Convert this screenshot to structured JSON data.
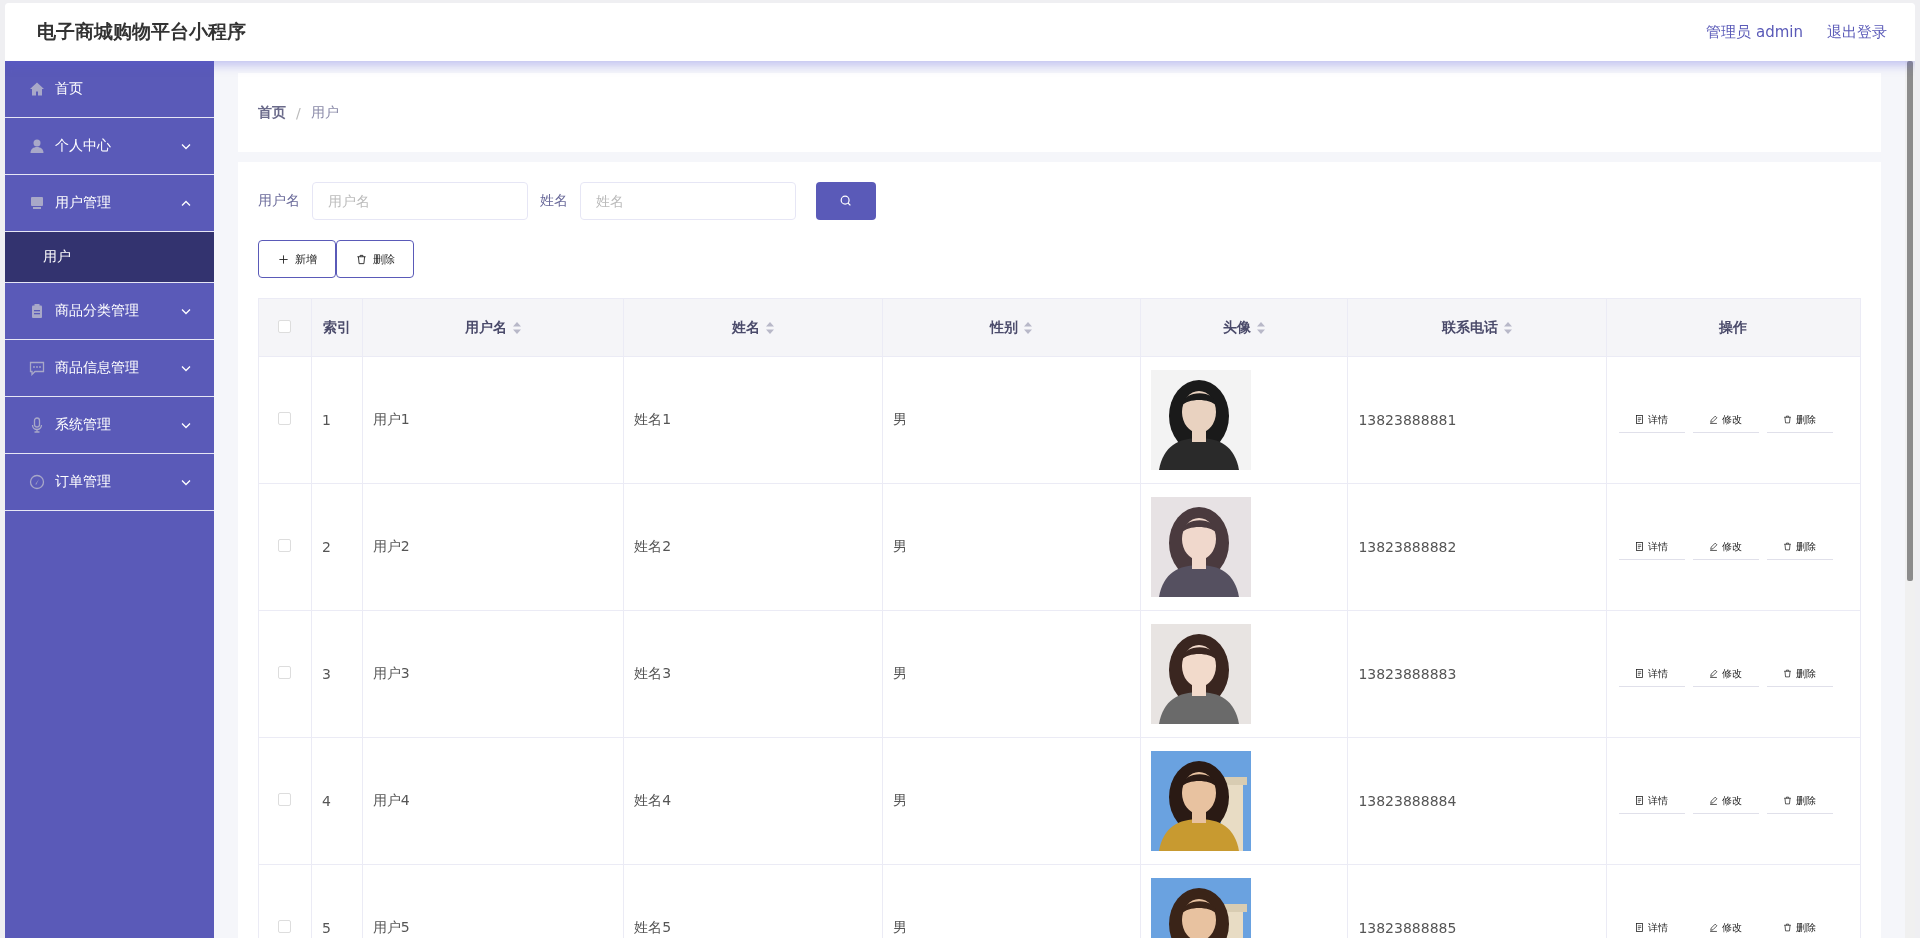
{
  "header": {
    "title": "电子商城购物平台小程序",
    "user_label": "管理员 admin",
    "logout": "退出登录"
  },
  "sidebar": {
    "items": [
      {
        "label": "首页"
      },
      {
        "label": "个人中心",
        "expanded": false
      },
      {
        "label": "用户管理",
        "expanded": true,
        "children": [
          {
            "label": "用户",
            "selected": true
          }
        ]
      },
      {
        "label": "商品分类管理",
        "expanded": false
      },
      {
        "label": "商品信息管理",
        "expanded": false
      },
      {
        "label": "系统管理",
        "expanded": false
      },
      {
        "label": "订单管理",
        "expanded": false
      }
    ]
  },
  "breadcrumb": {
    "items": [
      "首页",
      "用户"
    ],
    "separator": "/"
  },
  "search": {
    "fields": [
      {
        "label": "用户名",
        "placeholder": "用户名"
      },
      {
        "label": "姓名",
        "placeholder": "姓名"
      }
    ]
  },
  "toolbar": {
    "buttons": [
      "新增",
      "删除"
    ]
  },
  "table": {
    "select_all": {
      "checked": false
    },
    "columns": [
      {
        "label": "索引",
        "sortable": false
      },
      {
        "label": "用户名",
        "sortable": true
      },
      {
        "label": "姓名",
        "sortable": true
      },
      {
        "label": "性别",
        "sortable": true
      },
      {
        "label": "头像",
        "sortable": true
      },
      {
        "label": "联系电话",
        "sortable": true
      },
      {
        "label": "操作",
        "sortable": false
      }
    ],
    "rows": [
      {
        "checked": false,
        "cells": [
          "1",
          "用户1",
          "姓名1",
          "男"
        ],
        "avatar": {
          "kind": "picture"
        },
        "phone": "13823888881",
        "actions": [
          "详情",
          "修改",
          "删除"
        ]
      },
      {
        "checked": false,
        "cells": [
          "2",
          "用户2",
          "姓名2",
          "男"
        ],
        "avatar": {
          "kind": "picture"
        },
        "phone": "13823888882",
        "actions": [
          "详情",
          "修改",
          "删除"
        ]
      },
      {
        "checked": false,
        "cells": [
          "3",
          "用户3",
          "姓名3",
          "男"
        ],
        "avatar": {
          "kind": "picture"
        },
        "phone": "13823888883",
        "actions": [
          "详情",
          "修改",
          "删除"
        ]
      },
      {
        "checked": false,
        "cells": [
          "4",
          "用户4",
          "姓名4",
          "男"
        ],
        "avatar": {
          "kind": "picture"
        },
        "phone": "13823888884",
        "actions": [
          "详情",
          "修改",
          "删除"
        ]
      },
      {
        "checked": false,
        "cells": [
          "5",
          "用户5",
          "姓名5",
          "男"
        ],
        "avatar": {
          "kind": "picture"
        },
        "phone": "13823888885",
        "actions": [
          "详情",
          "修改",
          "删除"
        ]
      }
    ]
  }
}
